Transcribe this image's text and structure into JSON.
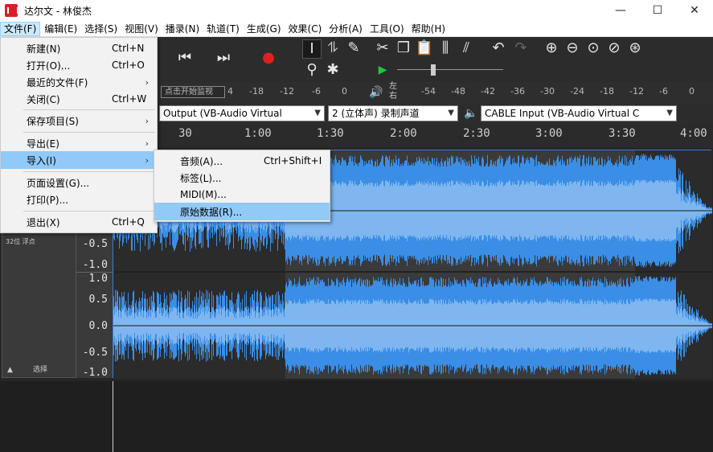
{
  "window": {
    "title": "达尔文 - 林俊杰",
    "buttons": [
      "—",
      "☐",
      "✕"
    ]
  },
  "menubar": {
    "items": [
      "文件(F)",
      "编辑(E)",
      "选择(S)",
      "视图(V)",
      "播录(N)",
      "轨道(T)",
      "生成(G)",
      "效果(C)",
      "分析(A)",
      "工具(O)",
      "帮助(H)"
    ]
  },
  "file_menu": {
    "items": [
      {
        "label": "新建(N)",
        "shortcut": "Ctrl+N"
      },
      {
        "label": "打开(O)...",
        "shortcut": "Ctrl+O"
      },
      {
        "label": "最近的文件(F)",
        "submenu": "›"
      },
      {
        "label": "关闭(C)",
        "shortcut": "Ctrl+W"
      },
      {
        "label": "保存项目(S)",
        "submenu": "›"
      },
      {
        "label": "导出(E)",
        "submenu": "›"
      },
      {
        "label": "导入(I)",
        "submenu": "›"
      },
      {
        "label": "页面设置(G)..."
      },
      {
        "label": "打印(P)..."
      },
      {
        "label": "退出(X)",
        "shortcut": "Ctrl+Q"
      }
    ]
  },
  "import_submenu": {
    "items": [
      {
        "label": "音频(A)...",
        "shortcut": "Ctrl+Shift+I"
      },
      {
        "label": "标签(L)..."
      },
      {
        "label": "MIDI(M)..."
      },
      {
        "label": "原始数据(R)..."
      }
    ]
  },
  "meter": {
    "click_label": "点击开始监视",
    "left_ticks": [
      "4",
      "-18",
      "-12",
      "-6",
      "0"
    ],
    "channel_label_top": "左",
    "channel_label_bottom": "右",
    "right_ticks": [
      "-54",
      "-48",
      "-42",
      "-36",
      "-30",
      "-24",
      "-18",
      "-12",
      "-6",
      "0"
    ]
  },
  "devices": {
    "output": "Output (VB-Audio Virtual",
    "channels": "2 (立体声) 录制声道",
    "input": "CABLE Input (VB-Audio Virtual C"
  },
  "ruler": {
    "labels": [
      "30",
      "1:00",
      "1:30",
      "2:00",
      "2:30",
      "3:00",
      "3:30",
      "4:00"
    ]
  },
  "track": {
    "format": "32位 浮点",
    "collapse": "▲",
    "select": "选择",
    "scale_top": [
      "-0.5",
      "-1.0"
    ],
    "scale_bottom": [
      "1.0",
      "0.5",
      "0.0",
      "-0.5",
      "-1.0"
    ]
  },
  "colors": {
    "waveform_selected": "#3a8ee6",
    "waveform_rms": "#7fb6f0",
    "waveform_unselected": "#3a8ee6",
    "track_bg_unselected": "#2b2b2b",
    "track_bg_selected": "#e8e8e8",
    "highlight": "#91c9f7"
  }
}
